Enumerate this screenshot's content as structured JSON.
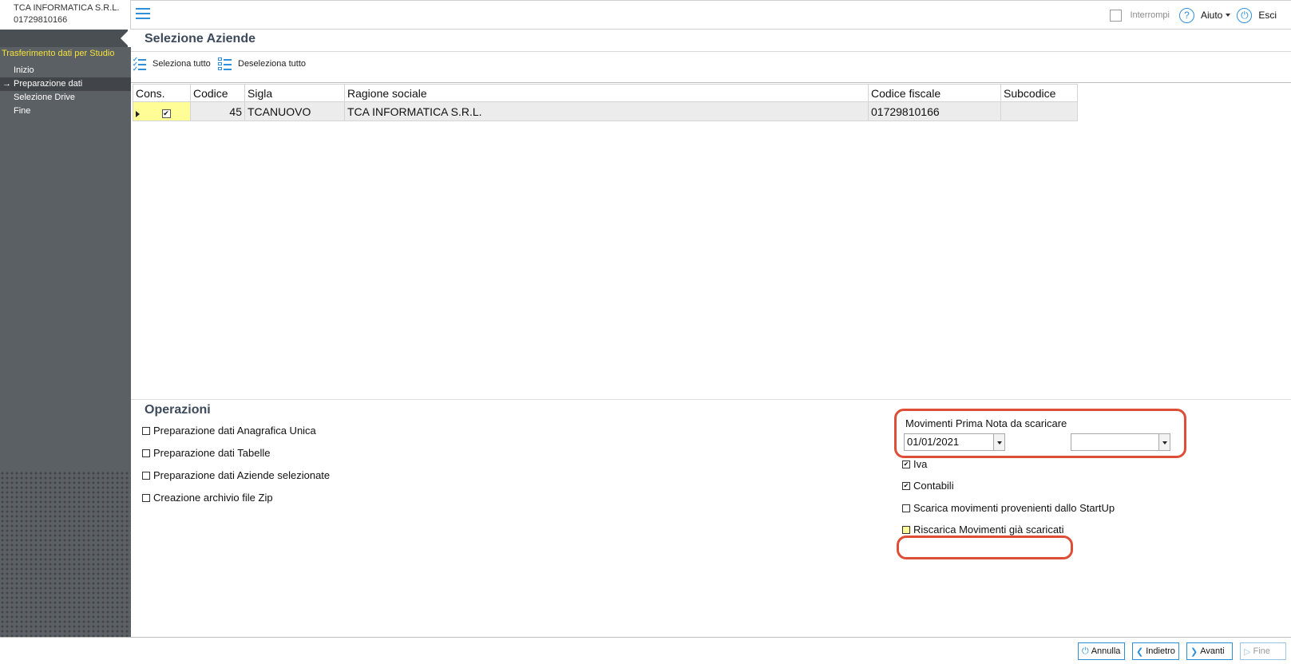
{
  "company": {
    "name": "TCA INFORMATICA S.R.L.",
    "code": "01729810166"
  },
  "sidebar": {
    "title": "Trasferimento dati per Studio",
    "items": [
      {
        "label": "Inizio",
        "active": false
      },
      {
        "label": "Preparazione dati",
        "active": true
      },
      {
        "label": "Selezione Drive",
        "active": false
      },
      {
        "label": "Fine",
        "active": false
      }
    ]
  },
  "topbar": {
    "interrompi": "Interrompi",
    "aiuto": "Aiuto",
    "esci": "Esci"
  },
  "main": {
    "title": "Selezione Aziende",
    "select_all": "Seleziona tutto",
    "deselect_all": "Deseleziona tutto"
  },
  "grid": {
    "columns": [
      "Cons.",
      "Codice",
      "Sigla",
      "Ragione sociale",
      "Codice fiscale",
      "Subcodice"
    ],
    "rows": [
      {
        "cons": true,
        "codice": "45",
        "sigla": "TCANUOVO",
        "ragione": "TCA INFORMATICA S.R.L.",
        "cf": "01729810166",
        "sub": ""
      }
    ]
  },
  "operations": {
    "title": "Operazioni",
    "items": [
      {
        "label": "Preparazione dati Anagrafica Unica",
        "checked": false
      },
      {
        "label": "Preparazione dati Tabelle",
        "checked": false
      },
      {
        "label": "Preparazione dati Aziende selezionate",
        "checked": false
      },
      {
        "label": "Creazione archivio file Zip",
        "checked": false
      }
    ],
    "movimenti_label": "Movimenti Prima Nota da scaricare",
    "date_from": "01/01/2021",
    "date_to": "",
    "iva": {
      "label": "Iva",
      "checked": true
    },
    "contabili": {
      "label": "Contabili",
      "checked": true
    },
    "startup": {
      "label": "Scarica movimenti provenienti dallo StartUp",
      "checked": false
    },
    "riscarica": {
      "label": "Riscarica Movimenti già scaricati",
      "checked": false
    }
  },
  "footer": {
    "annulla": "Annulla",
    "indietro": "Indietro",
    "avanti": "Avanti",
    "fine": "Fine"
  },
  "colors": {
    "accent": "#2f8fd8",
    "sidebar": "#5b6064",
    "highlight": "#de4d36",
    "selected_cell": "#fffd95",
    "sidebar_title": "#f5e23a"
  }
}
